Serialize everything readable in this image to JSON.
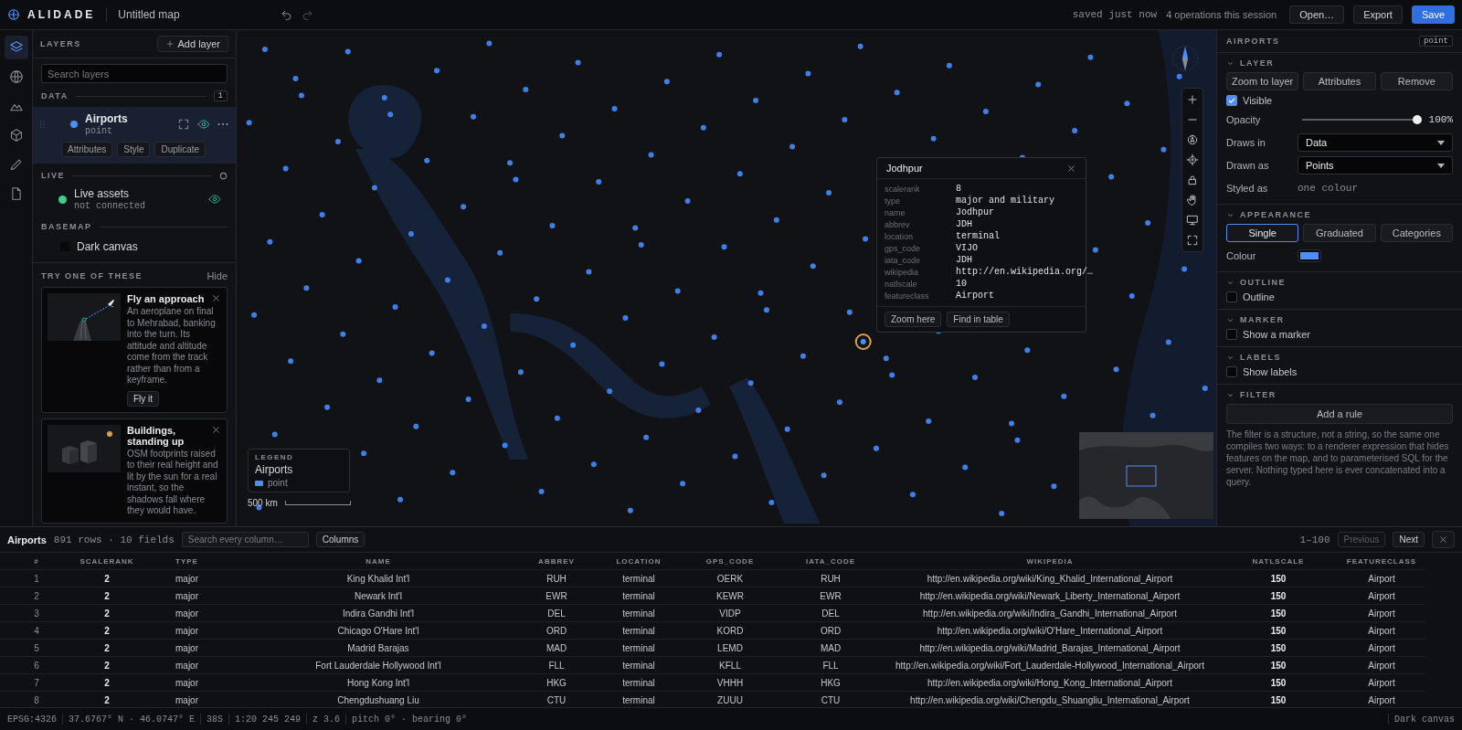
{
  "topbar": {
    "app_name": "ALIDADE",
    "map_title": "Untitled map",
    "save_status": "saved just now",
    "operations": "4 operations this session",
    "buttons": [
      {
        "label": "Open…",
        "primary": false
      },
      {
        "label": "Export",
        "primary": false
      },
      {
        "label": "Save",
        "primary": true
      }
    ]
  },
  "rail": [
    {
      "kind": "layers",
      "selected": true
    },
    {
      "kind": "globe",
      "selected": false
    },
    {
      "kind": "terrain",
      "selected": false
    },
    {
      "kind": "cube",
      "selected": false
    },
    {
      "kind": "pencil",
      "selected": false
    },
    {
      "kind": "file",
      "selected": false
    }
  ],
  "layers_panel": {
    "title": "LAYERS",
    "add_button": "Add layer",
    "search": {
      "placeholder": "Search layers"
    },
    "data": {
      "title": "DATA",
      "count": "1",
      "layers": [
        {
          "name": "Airports",
          "geometry": "point",
          "color": "#4f8ef7",
          "visible": true,
          "selected": true,
          "actions": [
            "Attributes",
            "Style",
            "Duplicate"
          ]
        }
      ]
    },
    "live": {
      "title": "LIVE",
      "layers": [
        {
          "name": "Live assets",
          "status": "not connected",
          "color": "#3ecf8e",
          "visible": true
        }
      ]
    },
    "basemap": {
      "title": "BASEMAP",
      "name": "Dark canvas"
    },
    "suggestions": {
      "title": "TRY ONE OF THESE",
      "hide": "Hide",
      "cards": [
        {
          "kind": "flight",
          "title": "Fly an approach",
          "text": "An aeroplane on final to Mehrabad, banking into the turn. Its attitude and altitude come from the track rather than from a keyframe.",
          "action": "Fly it"
        },
        {
          "kind": "buildings",
          "title": "Buildings, standing up",
          "text": "OSM footprints raised to their real height and lit by the sun for a real instant, so the shadows fall where they would have."
        }
      ]
    }
  },
  "map": {
    "tools": [
      {
        "kind": "zoom-in"
      },
      {
        "kind": "zoom-out"
      },
      {
        "kind": "north"
      },
      {
        "kind": "locate"
      },
      {
        "kind": "lock"
      },
      {
        "kind": "pan"
      },
      {
        "kind": "display"
      },
      {
        "kind": "fullscreen"
      }
    ],
    "popup": {
      "title": "Jodhpur",
      "fields": [
        {
          "key": "scalerank",
          "value": "8"
        },
        {
          "key": "type",
          "value": "major and military"
        },
        {
          "key": "name",
          "value": "Jodhpur"
        },
        {
          "key": "abbrev",
          "value": "JDH"
        },
        {
          "key": "location",
          "value": "terminal"
        },
        {
          "key": "gps_code",
          "value": "VIJO"
        },
        {
          "key": "iata_code",
          "value": "JDH"
        },
        {
          "key": "wikipedia",
          "value": "http://en.wikipedia.org/…"
        },
        {
          "key": "natlscale",
          "value": "10"
        },
        {
          "key": "featureclass",
          "value": "Airport"
        }
      ],
      "buttons": [
        "Zoom here",
        "Find in table"
      ]
    },
    "legend": {
      "title": "LEGEND",
      "layer": "Airports",
      "geometry": "point",
      "color": "#4f8ef7"
    },
    "scale": "500 km"
  },
  "inspector": {
    "title": "AIRPORTS",
    "badge": "point",
    "layer": {
      "title": "LAYER",
      "expanded": true,
      "buttons": [
        "Zoom to layer",
        "Attributes",
        "Remove"
      ],
      "visible": {
        "label": "Visible",
        "checked": true
      },
      "opacity": {
        "label": "Opacity",
        "level": 1,
        "reading": "100%"
      },
      "draws_in": {
        "label": "Draws in",
        "value": "Data"
      },
      "drawn_as": {
        "label": "Drawn as",
        "value": "Points"
      },
      "styled_as": {
        "label": "Styled as",
        "value": "one colour"
      }
    },
    "appearance": {
      "title": "APPEARANCE",
      "expanded": true,
      "modes": [
        {
          "label": "Single",
          "selected": true
        },
        {
          "label": "Graduated",
          "selected": false
        },
        {
          "label": "Categories",
          "selected": false
        }
      ],
      "colour": {
        "label": "Colour",
        "color": "#4f8ef7"
      }
    },
    "toggles": [
      {
        "title": "OUTLINE",
        "expanded": true,
        "label": "Outline",
        "checked": false
      },
      {
        "title": "MARKER",
        "expanded": true,
        "label": "Show a marker",
        "checked": false
      },
      {
        "title": "LABELS",
        "expanded": true,
        "label": "Show labels",
        "checked": false
      }
    ],
    "filter": {
      "title": "FILTER",
      "expanded": true,
      "button": "Add a rule",
      "note": "The filter is a structure, not a string, so the same one compiles two ways: to a renderer expression that hides features on the map, and to parameterised SQL for the server. Nothing typed here is ever concatenated into a query."
    }
  },
  "table": {
    "title": "Airports",
    "meta": "891 rows · 10 fields",
    "search": {
      "placeholder": "Search every column…"
    },
    "columns_button": "Columns",
    "range": "1–100",
    "previous": {
      "label": "Previous",
      "disabled": true
    },
    "next": {
      "label": "Next",
      "disabled": false
    },
    "columns": [
      "#",
      "SCALERANK",
      "TYPE",
      "NAME",
      "ABBREV",
      "LOCATION",
      "GPS_CODE",
      "IATA_CODE",
      "WIKIPEDIA",
      "NATLSCALE",
      "FEATURECLASS"
    ],
    "rows": [
      [
        "1",
        "2",
        "major",
        "King Khalid Int'l",
        "RUH",
        "terminal",
        "OERK",
        "RUH",
        "http://en.wikipedia.org/wiki/King_Khalid_International_Airport",
        "150",
        "Airport"
      ],
      [
        "2",
        "2",
        "major",
        "Newark Int'l",
        "EWR",
        "terminal",
        "KEWR",
        "EWR",
        "http://en.wikipedia.org/wiki/Newark_Liberty_International_Airport",
        "150",
        "Airport"
      ],
      [
        "3",
        "2",
        "major",
        "Indira Gandhi Int'l",
        "DEL",
        "terminal",
        "VIDP",
        "DEL",
        "http://en.wikipedia.org/wiki/Indira_Gandhi_International_Airport",
        "150",
        "Airport"
      ],
      [
        "4",
        "2",
        "major",
        "Chicago O'Hare Int'l",
        "ORD",
        "terminal",
        "KORD",
        "ORD",
        "http://en.wikipedia.org/wiki/O'Hare_International_Airport",
        "150",
        "Airport"
      ],
      [
        "5",
        "2",
        "major",
        "Madrid Barajas",
        "MAD",
        "terminal",
        "LEMD",
        "MAD",
        "http://en.wikipedia.org/wiki/Madrid_Barajas_International_Airport",
        "150",
        "Airport"
      ],
      [
        "6",
        "2",
        "major",
        "Fort Lauderdale Hollywood Int'l",
        "FLL",
        "terminal",
        "KFLL",
        "FLL",
        "http://en.wikipedia.org/wiki/Fort_Lauderdale-Hollywood_International_Airport",
        "150",
        "Airport"
      ],
      [
        "7",
        "2",
        "major",
        "Hong Kong Int'l",
        "HKG",
        "terminal",
        "VHHH",
        "HKG",
        "http://en.wikipedia.org/wiki/Hong_Kong_International_Airport",
        "150",
        "Airport"
      ],
      [
        "8",
        "2",
        "major",
        "Chengdushuang Liu",
        "CTU",
        "terminal",
        "ZUUU",
        "CTU",
        "http://en.wikipedia.org/wiki/Chengdu_Shuangliu_International_Airport",
        "150",
        "Airport"
      ]
    ]
  },
  "status_bar": {
    "items": [
      "EPSG:4326",
      "37.6767° N · 46.0747° E",
      "38S",
      "1:20 245 249",
      "z 3.6",
      "pitch 0° · bearing 0°"
    ],
    "basemap": "Dark canvas"
  }
}
